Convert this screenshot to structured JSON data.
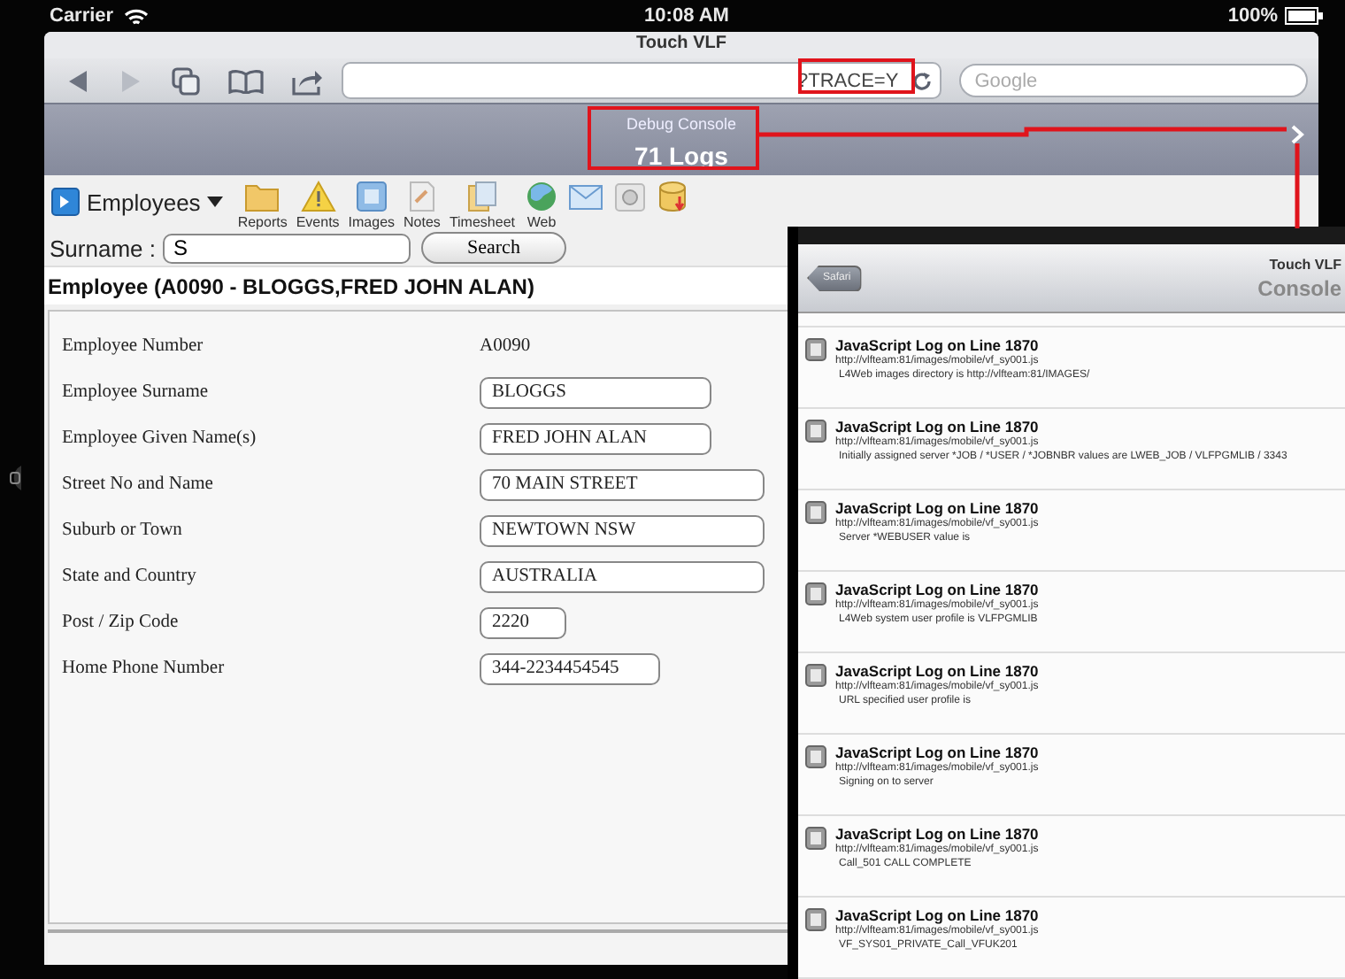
{
  "status_bar": {
    "carrier": "Carrier",
    "time": "10:08 AM",
    "battery": "100%"
  },
  "browser": {
    "title": "Touch VLF",
    "url": "?TRACE=Y",
    "search": {
      "placeholder": "Google"
    }
  },
  "debug_console": {
    "title": "Debug Console",
    "count": "71 Logs"
  },
  "app": {
    "menu": {
      "label": "Employees"
    },
    "toolbar": [
      {
        "kind": "folder",
        "label": "Reports"
      },
      {
        "kind": "warning",
        "label": "Events"
      },
      {
        "kind": "images",
        "label": "Images"
      },
      {
        "kind": "notes",
        "label": "Notes"
      },
      {
        "kind": "timesheet",
        "label": "Timesheet"
      },
      {
        "kind": "web",
        "label": "Web"
      },
      {
        "kind": "mail"
      },
      {
        "kind": "disc"
      },
      {
        "kind": "database"
      }
    ],
    "search": {
      "label": "Surname :",
      "value": "S",
      "button": "Search"
    },
    "heading": "Employee (A0090 - BLOGGS,FRED JOHN ALAN)",
    "fields": [
      {
        "kind": "text",
        "label": "Employee Number",
        "value": "A0090"
      },
      {
        "kind": "input",
        "label": "Employee Surname",
        "value": "BLOGGS"
      },
      {
        "kind": "input",
        "label": "Employee Given Name(s)",
        "value": "FRED JOHN ALAN"
      },
      {
        "kind": "input",
        "label": "Street No and Name",
        "value": "70 MAIN STREET"
      },
      {
        "kind": "input",
        "label": "Suburb or Town",
        "value": "NEWTOWN NSW"
      },
      {
        "kind": "input",
        "label": "State and Country",
        "value": "AUSTRALIA"
      },
      {
        "kind": "input",
        "label": "Post / Zip Code",
        "value": "2220"
      },
      {
        "kind": "input",
        "label": "Home Phone Number",
        "value": "344-2234454545"
      }
    ]
  },
  "console_inset": {
    "back": "Safari",
    "title": "Touch VLF",
    "heading": "Console",
    "logs": [
      {
        "title": "JavaScript Log on Line 1870",
        "source": "http://vlfteam:81/images/mobile/vf_sy001.js",
        "message": "L4Web images directory is http://vlfteam:81/IMAGES/"
      },
      {
        "title": "JavaScript Log on Line 1870",
        "source": "http://vlfteam:81/images/mobile/vf_sy001.js",
        "message": "Initially assigned server *JOB / *USER / *JOBNBR values are LWEB_JOB / VLFPGMLIB / 3343"
      },
      {
        "title": "JavaScript Log on Line 1870",
        "source": "http://vlfteam:81/images/mobile/vf_sy001.js",
        "message": "Server *WEBUSER value is"
      },
      {
        "title": "JavaScript Log on Line 1870",
        "source": "http://vlfteam:81/images/mobile/vf_sy001.js",
        "message": "L4Web system user profile is VLFPGMLIB"
      },
      {
        "title": "JavaScript Log on Line 1870",
        "source": "http://vlfteam:81/images/mobile/vf_sy001.js",
        "message": "URL specified user profile is"
      },
      {
        "title": "JavaScript Log on Line 1870",
        "source": "http://vlfteam:81/images/mobile/vf_sy001.js",
        "message": "Signing on to server"
      },
      {
        "title": "JavaScript Log on Line 1870",
        "source": "http://vlfteam:81/images/mobile/vf_sy001.js",
        "message": "Call_501 CALL COMPLETE"
      },
      {
        "title": "JavaScript Log on Line 1870",
        "source": "http://vlfteam:81/images/mobile/vf_sy001.js",
        "message": "VF_SYS01_PRIVATE_Call_VFUK201"
      }
    ]
  }
}
